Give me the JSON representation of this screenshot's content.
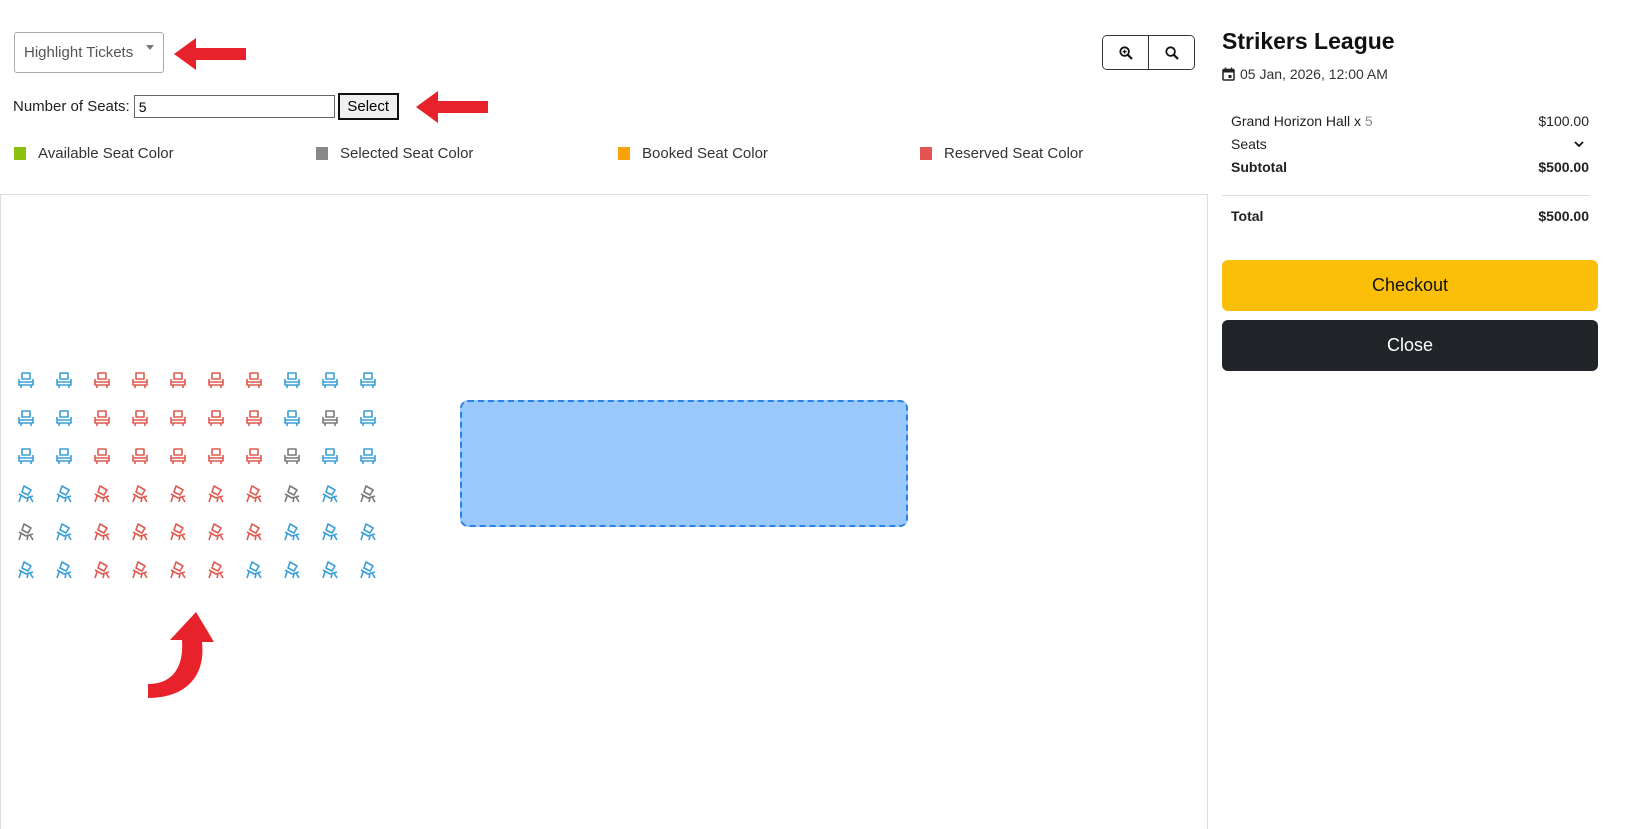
{
  "toolbar": {
    "highlight_label": "Highlight Tickets",
    "seats_label": "Number of Seats:",
    "seats_value": "5",
    "select_label": "Select"
  },
  "legend": [
    {
      "label": "Available Seat Color",
      "color": "#8bc10c"
    },
    {
      "label": "Selected Seat Color",
      "color": "#888888"
    },
    {
      "label": "Booked Seat Color",
      "color": "#f8a10a"
    },
    {
      "label": "Reserved Seat Color",
      "color": "#e55353"
    }
  ],
  "zoom": {
    "in_icon": "zoom-in-icon",
    "out_icon": "zoom-out-icon"
  },
  "seat_colors": {
    "blue": "#3a9fd6",
    "red": "#e05a4f",
    "gray": "#7a7a7a"
  },
  "seat_grid": [
    [
      "blue",
      "blue",
      "red",
      "red",
      "red",
      "red",
      "red",
      "blue",
      "blue",
      "blue"
    ],
    [
      "blue",
      "blue",
      "red",
      "red",
      "red",
      "red",
      "red",
      "blue",
      "gray",
      "blue"
    ],
    [
      "blue",
      "blue",
      "red",
      "red",
      "red",
      "red",
      "red",
      "gray",
      "blue",
      "blue"
    ],
    [
      "blue",
      "blue",
      "red",
      "red",
      "red",
      "red",
      "red",
      "gray",
      "blue",
      "gray"
    ],
    [
      "gray",
      "blue",
      "red",
      "red",
      "red",
      "red",
      "red",
      "blue",
      "blue",
      "blue"
    ],
    [
      "blue",
      "blue",
      "red",
      "red",
      "red",
      "red",
      "blue",
      "blue",
      "blue",
      "blue"
    ]
  ],
  "seat_orientation": [
    "upright",
    "upright",
    "upright",
    "tilted",
    "tilted",
    "tilted"
  ],
  "event": {
    "title": "Strikers League",
    "date": "05 Jan, 2026, 12:00 AM"
  },
  "summary": {
    "ticket_name": "Grand Horizon Hall x ",
    "ticket_qty": "5",
    "ticket_price": "$100.00",
    "seats_label": "Seats",
    "subtotal_label": "Subtotal",
    "subtotal_value": "$500.00",
    "total_label": "Total",
    "total_value": "$500.00"
  },
  "actions": {
    "checkout_label": "Checkout",
    "close_label": "Close"
  },
  "annotation_color": "#e8222a"
}
